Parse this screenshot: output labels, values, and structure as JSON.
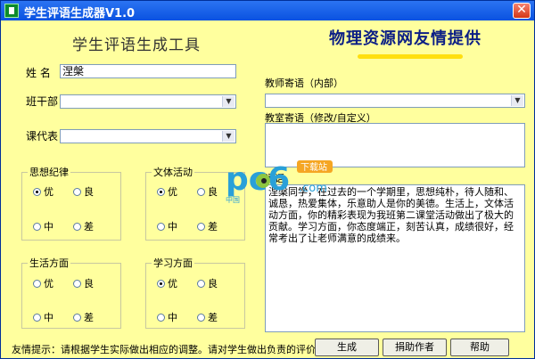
{
  "window": {
    "title": "学生评语生成器V1.0",
    "close_glyph": "✕"
  },
  "header": {
    "app_title": "学生评语生成工具",
    "banner": "物理资源网友情提供"
  },
  "fields": {
    "name_label": "姓  名",
    "name_value": "涅槃",
    "class_cadre_label": "班干部",
    "course_rep_label": "课代表"
  },
  "groups": {
    "thought": {
      "title": "思想纪律",
      "options": [
        "优",
        "良",
        "中",
        "差"
      ],
      "selected": "优"
    },
    "literary": {
      "title": "文体活动",
      "options": [
        "优",
        "良",
        "中",
        "差"
      ],
      "selected": "优"
    },
    "life": {
      "title": "生活方面",
      "options": [
        "优",
        "良",
        "中",
        "差"
      ],
      "selected": ""
    },
    "study": {
      "title": "学习方面",
      "options": [
        "优",
        "良",
        "中",
        "差"
      ],
      "selected": "优"
    }
  },
  "teacher_message": {
    "label": "教师寄语（内部）"
  },
  "class_message": {
    "label": "教室寄语（修改/自定义）"
  },
  "comment": {
    "label": "评语",
    "text": "涅槃同学，在过去的一个学期里，思想纯朴，待人随和、诚恳，热爱集体，乐意助人是你的美德。生活上，文体活动方面，你的精彩表现为我班第二课堂活动做出了极大的贡献。学习方面，你态度端正，刻苦认真，成绩很好，经常考出了让老师满意的成绩来。"
  },
  "buttons": {
    "generate": "生成",
    "donate": "捐助作者",
    "help": "帮助"
  },
  "footer": {
    "tip": "友情提示：请根据学生实际做出相应的调整。请对学生做出负责的评价。"
  },
  "watermark": {
    "logo_text": "pc6",
    "tag": "下载站",
    "url": ".com",
    "cn": "中国"
  },
  "colors": {
    "background": "#ffff9e",
    "titlebar": "#0a52e0",
    "banner": "#0b1e85"
  }
}
